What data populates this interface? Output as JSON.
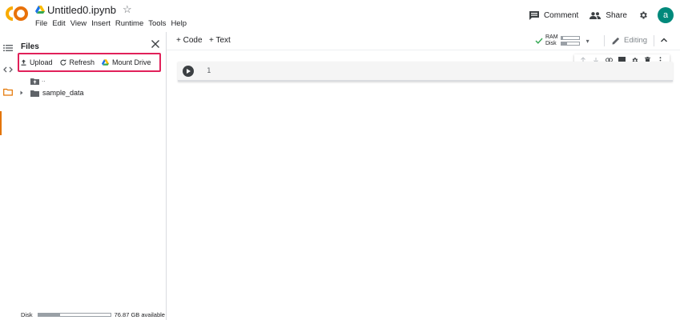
{
  "header": {
    "notebook_title": "Untitled0.ipynb",
    "menu": [
      "File",
      "Edit",
      "View",
      "Insert",
      "Runtime",
      "Tools",
      "Help"
    ],
    "comment_label": "Comment",
    "share_label": "Share",
    "avatar_initial": "a",
    "avatar_color": "#00897b"
  },
  "files_panel": {
    "title": "Files",
    "toolbar": {
      "upload": "Upload",
      "refresh": "Refresh",
      "mount_drive": "Mount Drive"
    },
    "tree": {
      "parent": "..",
      "folders": [
        "sample_data"
      ]
    },
    "disk": {
      "label": "Disk",
      "available": "76.87 GB available",
      "used_fraction": 0.3
    },
    "highlight_color": "#e1215a"
  },
  "notebook_toolbar": {
    "add_code": "+ Code",
    "add_text": "+ Text",
    "ram_label": "RAM",
    "disk_label": "Disk",
    "ram_fraction": 0.1,
    "disk_fraction": 0.35,
    "editing_label": "Editing"
  },
  "cell": {
    "line_number": "1"
  },
  "colors": {
    "accent_orange": "#e37400",
    "connected_green": "#34a853"
  }
}
